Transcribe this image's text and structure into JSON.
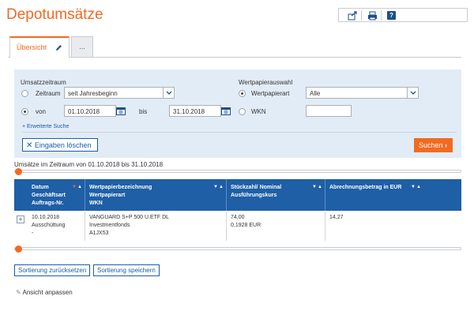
{
  "page": {
    "title": "Depotumsätze"
  },
  "toolbar": {
    "export_icon": "export-icon",
    "print_icon": "print-icon",
    "help_label": "?"
  },
  "tabs": [
    {
      "label": "Übersicht"
    },
    {
      "label": "..."
    }
  ],
  "filter": {
    "period_heading": "Umsatzzeitraum",
    "period_option_label": "Zeitraum",
    "period_select_value": "seit Jahresbeginn",
    "from_label": "von",
    "from_value": "01.10.2018",
    "to_label": "bis",
    "to_value": "31.10.2018",
    "securities_heading": "Wertpapierauswahl",
    "security_type_label": "Wertpapierart",
    "security_type_value": "Alle",
    "wkn_label": "WKN",
    "wkn_value": "",
    "advanced_label": "Erweiterte Suche",
    "clear_label": "Eingaben löschen",
    "search_label": "Suchen"
  },
  "range_text": "Umsätze im Zeitraum von 01.10.2018 bis 31.10.2018",
  "table": {
    "headers": [
      [
        "Datum",
        "Geschäftsart",
        "Auftrags-Nr."
      ],
      [
        "Wertpapierbezeichnung",
        "Wertpapierart",
        "WKN"
      ],
      [
        "Stückzahl/ Nominal",
        "Ausführungskurs"
      ],
      [
        "Abrechnungsbetrag in EUR"
      ]
    ],
    "rows": [
      {
        "date": "10.10.2018",
        "type": "Ausschüttung",
        "order": "-",
        "name": "VANGUARD S+P 500 U.ETF DL",
        "security_type": "Investmentfonds",
        "wkn": "A1JX53",
        "quantity": "74,00",
        "price": "0,1928 EUR",
        "amount": "14,27"
      }
    ]
  },
  "actions": {
    "reset_sort": "Sortierung zurücksetzen",
    "save_sort": "Sortierung speichern",
    "adjust_view": "Ansicht anpassen"
  },
  "colors": {
    "accent": "#f26a21",
    "primary": "#1e5fa6",
    "panel": "#e2ecf6"
  }
}
